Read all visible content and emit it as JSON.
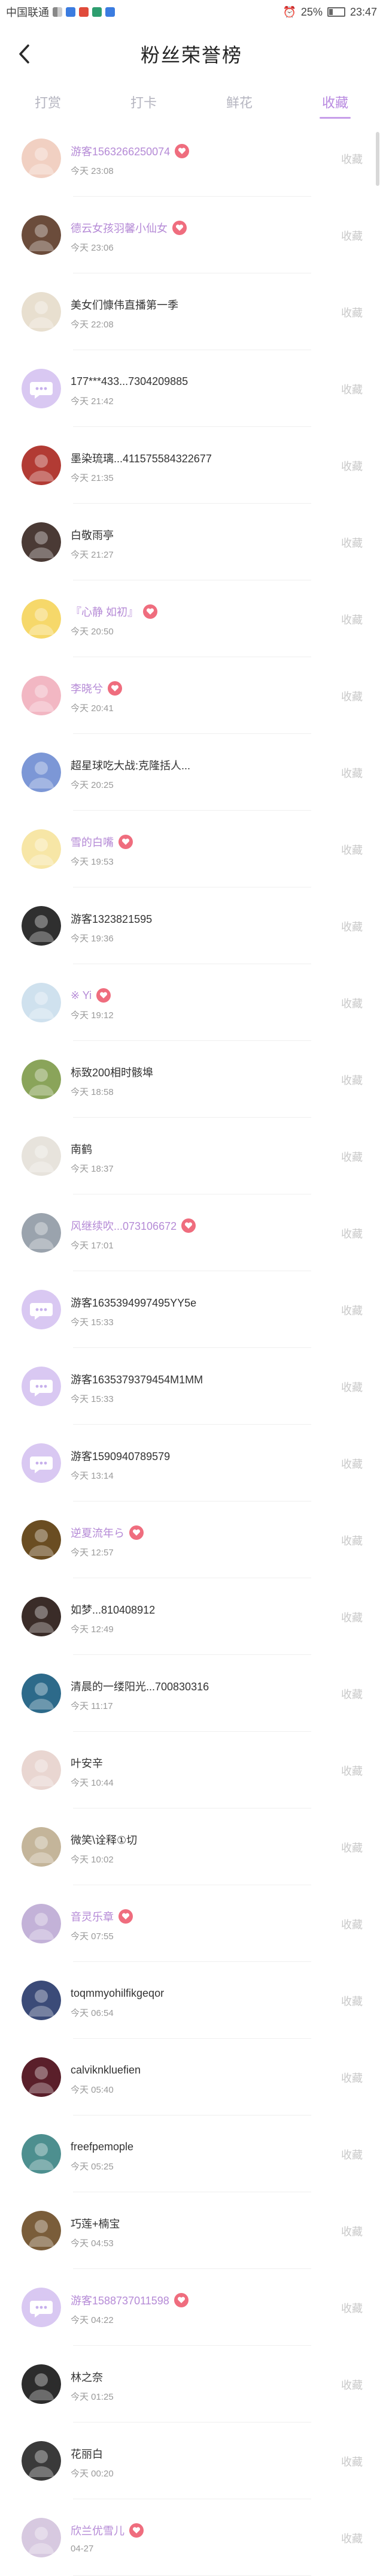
{
  "status_bar": {
    "carrier": "中国联通",
    "battery": "25%",
    "time": "23:47"
  },
  "header": {
    "title": "粉丝荣誉榜",
    "back_icon": "chevron-left-icon"
  },
  "tabs": [
    {
      "label": "打赏",
      "active": false
    },
    {
      "label": "打卡",
      "active": false
    },
    {
      "label": "鲜花",
      "active": false
    },
    {
      "label": "收藏",
      "active": true
    }
  ],
  "action_label": "收藏",
  "colors": {
    "accent": "#b889e0",
    "name_highlight": "#b58ad6",
    "vip_badge": "#ef6d7e",
    "muted": "#9a9a9a"
  },
  "items": [
    {
      "name": "游客1563266250074",
      "time": "今天 23:08",
      "vip": true,
      "avatar": "#f1d0c2"
    },
    {
      "name": "德云女孩羽馨小仙女",
      "time": "今天 23:06",
      "vip": true,
      "avatar": "#6b4c3b"
    },
    {
      "name": "美女们慷伟直播第一季",
      "time": "今天 22:08",
      "vip": false,
      "avatar": "#e8dfcf"
    },
    {
      "name": "177***433...7304209885",
      "time": "今天 21:42",
      "vip": false,
      "avatar": "chat"
    },
    {
      "name": "墨染琉璃...411575584322677",
      "time": "今天 21:35",
      "vip": false,
      "avatar": "#b23b34"
    },
    {
      "name": "白敬雨亭",
      "time": "今天 21:27",
      "vip": false,
      "avatar": "#4a3a35"
    },
    {
      "name": "『心静 如初』",
      "time": "今天 20:50",
      "vip": true,
      "avatar": "#f6d86a"
    },
    {
      "name": "李晓兮",
      "time": "今天 20:41",
      "vip": true,
      "avatar": "#f2b7c3"
    },
    {
      "name": "超星球吃大战:克隆括人...",
      "time": "今天 20:25",
      "vip": false,
      "avatar": "#7c97d6"
    },
    {
      "name": "雪的白嘴",
      "time": "今天 19:53",
      "vip": true,
      "avatar": "#f7e6a6"
    },
    {
      "name": "游客1323821595",
      "time": "今天 19:36",
      "vip": false,
      "avatar": "#2f2f2f"
    },
    {
      "name": "※ Yi",
      "time": "今天 19:12",
      "vip": true,
      "avatar": "#cfe1ee"
    },
    {
      "name": "标致200相时骸埠",
      "time": "今天 18:58",
      "vip": false,
      "avatar": "#8aa45a"
    },
    {
      "name": "南鹤",
      "time": "今天 18:37",
      "vip": false,
      "avatar": "#e7e3dc"
    },
    {
      "name": "风继续吹...073106672",
      "time": "今天 17:01",
      "vip": true,
      "avatar": "#9aa3ad"
    },
    {
      "name": "游客1635394997495YY5e",
      "time": "今天 15:33",
      "vip": false,
      "avatar": "chat"
    },
    {
      "name": "游客1635379379454M1MM",
      "time": "今天 15:33",
      "vip": false,
      "avatar": "chat"
    },
    {
      "name": "游客1590940789579",
      "time": "今天 13:14",
      "vip": false,
      "avatar": "chat"
    },
    {
      "name": "逆夏流年ら",
      "time": "今天 12:57",
      "vip": true,
      "avatar": "#6a4d22"
    },
    {
      "name": "如梦...810408912",
      "time": "今天 12:49",
      "vip": false,
      "avatar": "#3a2c28"
    },
    {
      "name": "清晨的一缕阳光...700830316",
      "time": "今天 11:17",
      "vip": false,
      "avatar": "#2d6a8a"
    },
    {
      "name": "叶安辛",
      "time": "今天 10:44",
      "vip": false,
      "avatar": "#e9d6d1"
    },
    {
      "name": "微笑\\诠释①切",
      "time": "今天 10:02",
      "vip": false,
      "avatar": "#c4b59a"
    },
    {
      "name": "音灵乐章",
      "time": "今天 07:55",
      "vip": true,
      "avatar": "#c3b2d8"
    },
    {
      "name": "toqmmyohilfikgeqor",
      "time": "今天 06:54",
      "vip": false,
      "avatar": "#3b4b78"
    },
    {
      "name": "calviknkluefien",
      "time": "今天 05:40",
      "vip": false,
      "avatar": "#5a1f2a"
    },
    {
      "name": "freefpemople",
      "time": "今天 05:25",
      "vip": false,
      "avatar": "#4d8f8f"
    },
    {
      "name": "巧莲+楠宝",
      "time": "今天 04:53",
      "vip": false,
      "avatar": "#7a5d3a"
    },
    {
      "name": "游客1588737011598",
      "time": "今天 04:22",
      "vip": true,
      "avatar": "chat"
    },
    {
      "name": "林之奈",
      "time": "今天 01:25",
      "vip": false,
      "avatar": "#2c2c2c"
    },
    {
      "name": "花丽白",
      "time": "今天 00:20",
      "vip": false,
      "avatar": "#3a3a3a"
    },
    {
      "name": "欣兰优雪儿",
      "time": "04-27",
      "vip": true,
      "avatar": "#d7c9e0"
    }
  ]
}
